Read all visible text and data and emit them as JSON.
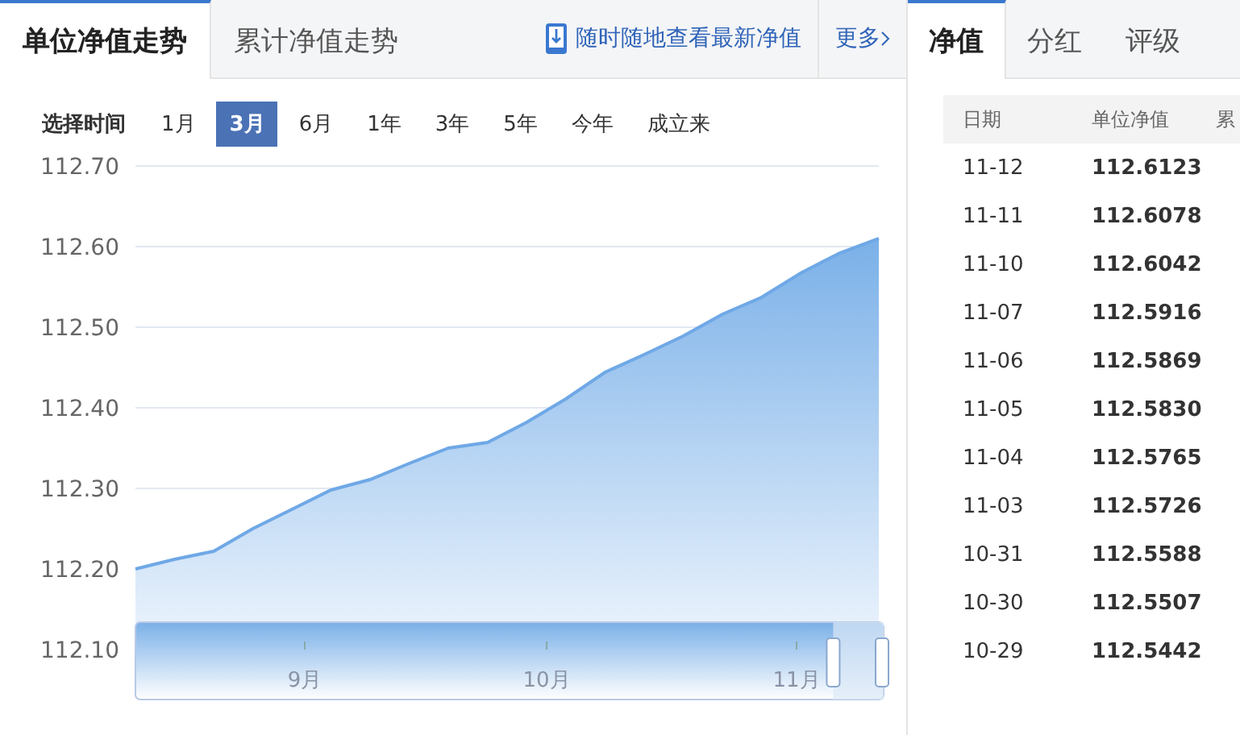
{
  "left_tabs": [
    {
      "label": "单位净值走势",
      "selected": true
    },
    {
      "label": "累计净值走势",
      "selected": false
    }
  ],
  "app_link": "随时随地查看最新净值",
  "more_link": "更多",
  "time_filter": {
    "label": "选择时间",
    "options": [
      {
        "label": "1月",
        "selected": false
      },
      {
        "label": "3月",
        "selected": true
      },
      {
        "label": "6月",
        "selected": false
      },
      {
        "label": "1年",
        "selected": false
      },
      {
        "label": "3年",
        "selected": false
      },
      {
        "label": "5年",
        "selected": false
      },
      {
        "label": "今年",
        "selected": false
      },
      {
        "label": "成立来",
        "selected": false
      }
    ]
  },
  "chart": {
    "chart_data": {
      "type": "area",
      "grid": true,
      "ylim": [
        112.1,
        112.7
      ],
      "yticks": [
        {
          "value": 112.1,
          "label": "112.10"
        },
        {
          "value": 112.2,
          "label": "112.20"
        },
        {
          "value": 112.3,
          "label": "112.30"
        },
        {
          "value": 112.4,
          "label": "112.40"
        },
        {
          "value": 112.5,
          "label": "112.50"
        },
        {
          "value": 112.6,
          "label": "112.60"
        },
        {
          "value": 112.7,
          "label": "112.70"
        }
      ],
      "values": [
        112.2,
        112.212,
        112.222,
        112.25,
        112.274,
        112.298,
        112.311,
        112.331,
        112.35,
        112.357,
        112.382,
        112.411,
        112.444,
        112.466,
        112.489,
        112.516,
        112.537,
        112.567,
        112.592,
        112.61
      ]
    },
    "zoom_slider": {
      "labels": [
        "9月",
        "10月",
        "11月"
      ],
      "level": 0.02
    }
  },
  "right_tabs": [
    {
      "label": "净值",
      "selected": true
    },
    {
      "label": "分红",
      "selected": false
    },
    {
      "label": "评级",
      "selected": false
    }
  ],
  "table": {
    "columns": [
      "日期",
      "单位净值",
      "累"
    ],
    "rows": [
      [
        "11-12",
        "112.6123"
      ],
      [
        "11-11",
        "112.6078"
      ],
      [
        "11-10",
        "112.6042"
      ],
      [
        "11-07",
        "112.5916"
      ],
      [
        "11-06",
        "112.5869"
      ],
      [
        "11-05",
        "112.5830"
      ],
      [
        "11-04",
        "112.5765"
      ],
      [
        "11-03",
        "112.5726"
      ],
      [
        "10-31",
        "112.5588"
      ],
      [
        "10-30",
        "112.5507"
      ],
      [
        "10-29",
        "112.5442"
      ]
    ]
  }
}
